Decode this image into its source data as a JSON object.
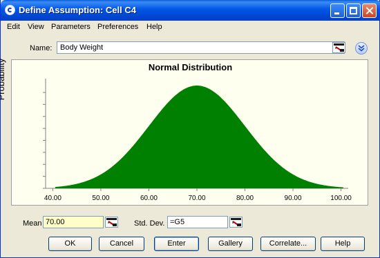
{
  "window": {
    "title": "Define Assumption: Cell C4"
  },
  "menu": [
    "Edit",
    "View",
    "Parameters",
    "Preferences",
    "Help"
  ],
  "name": {
    "label": "Name:",
    "value": "Body Weight"
  },
  "chart_data": {
    "type": "area",
    "title": "Normal Distribution",
    "xlabel": "",
    "ylabel": "Probability",
    "distribution": "normal",
    "mean": 70,
    "std_dev": 10,
    "xlim": [
      38.5,
      101.5
    ],
    "x_ticks": [
      "40.00",
      "50.00",
      "60.00",
      "70.00",
      "80.00",
      "90.00",
      "100.00"
    ],
    "x_tick_values": [
      40,
      50,
      60,
      70,
      80,
      90,
      100
    ],
    "fill_color": "#008000",
    "background_color": "#fffff0",
    "y_tick_count": 9
  },
  "params": {
    "mean_label": "Mean",
    "mean_value": "70.00",
    "sd_label": "Std. Dev.",
    "sd_value": "=G5"
  },
  "buttons": {
    "ok": "OK",
    "cancel": "Cancel",
    "enter": "Enter",
    "gallery": "Gallery",
    "correlate": "Correlate...",
    "help": "Help"
  },
  "colors": {
    "title_bar": "#0055e5",
    "dialog_bg": "#ece9d8",
    "mean_field_bg": "#ffffc8"
  },
  "icons": [
    "app-icon",
    "minimize-icon",
    "maximize-icon",
    "close-icon",
    "cell-reference-icon",
    "expand-chevron-icon"
  ]
}
